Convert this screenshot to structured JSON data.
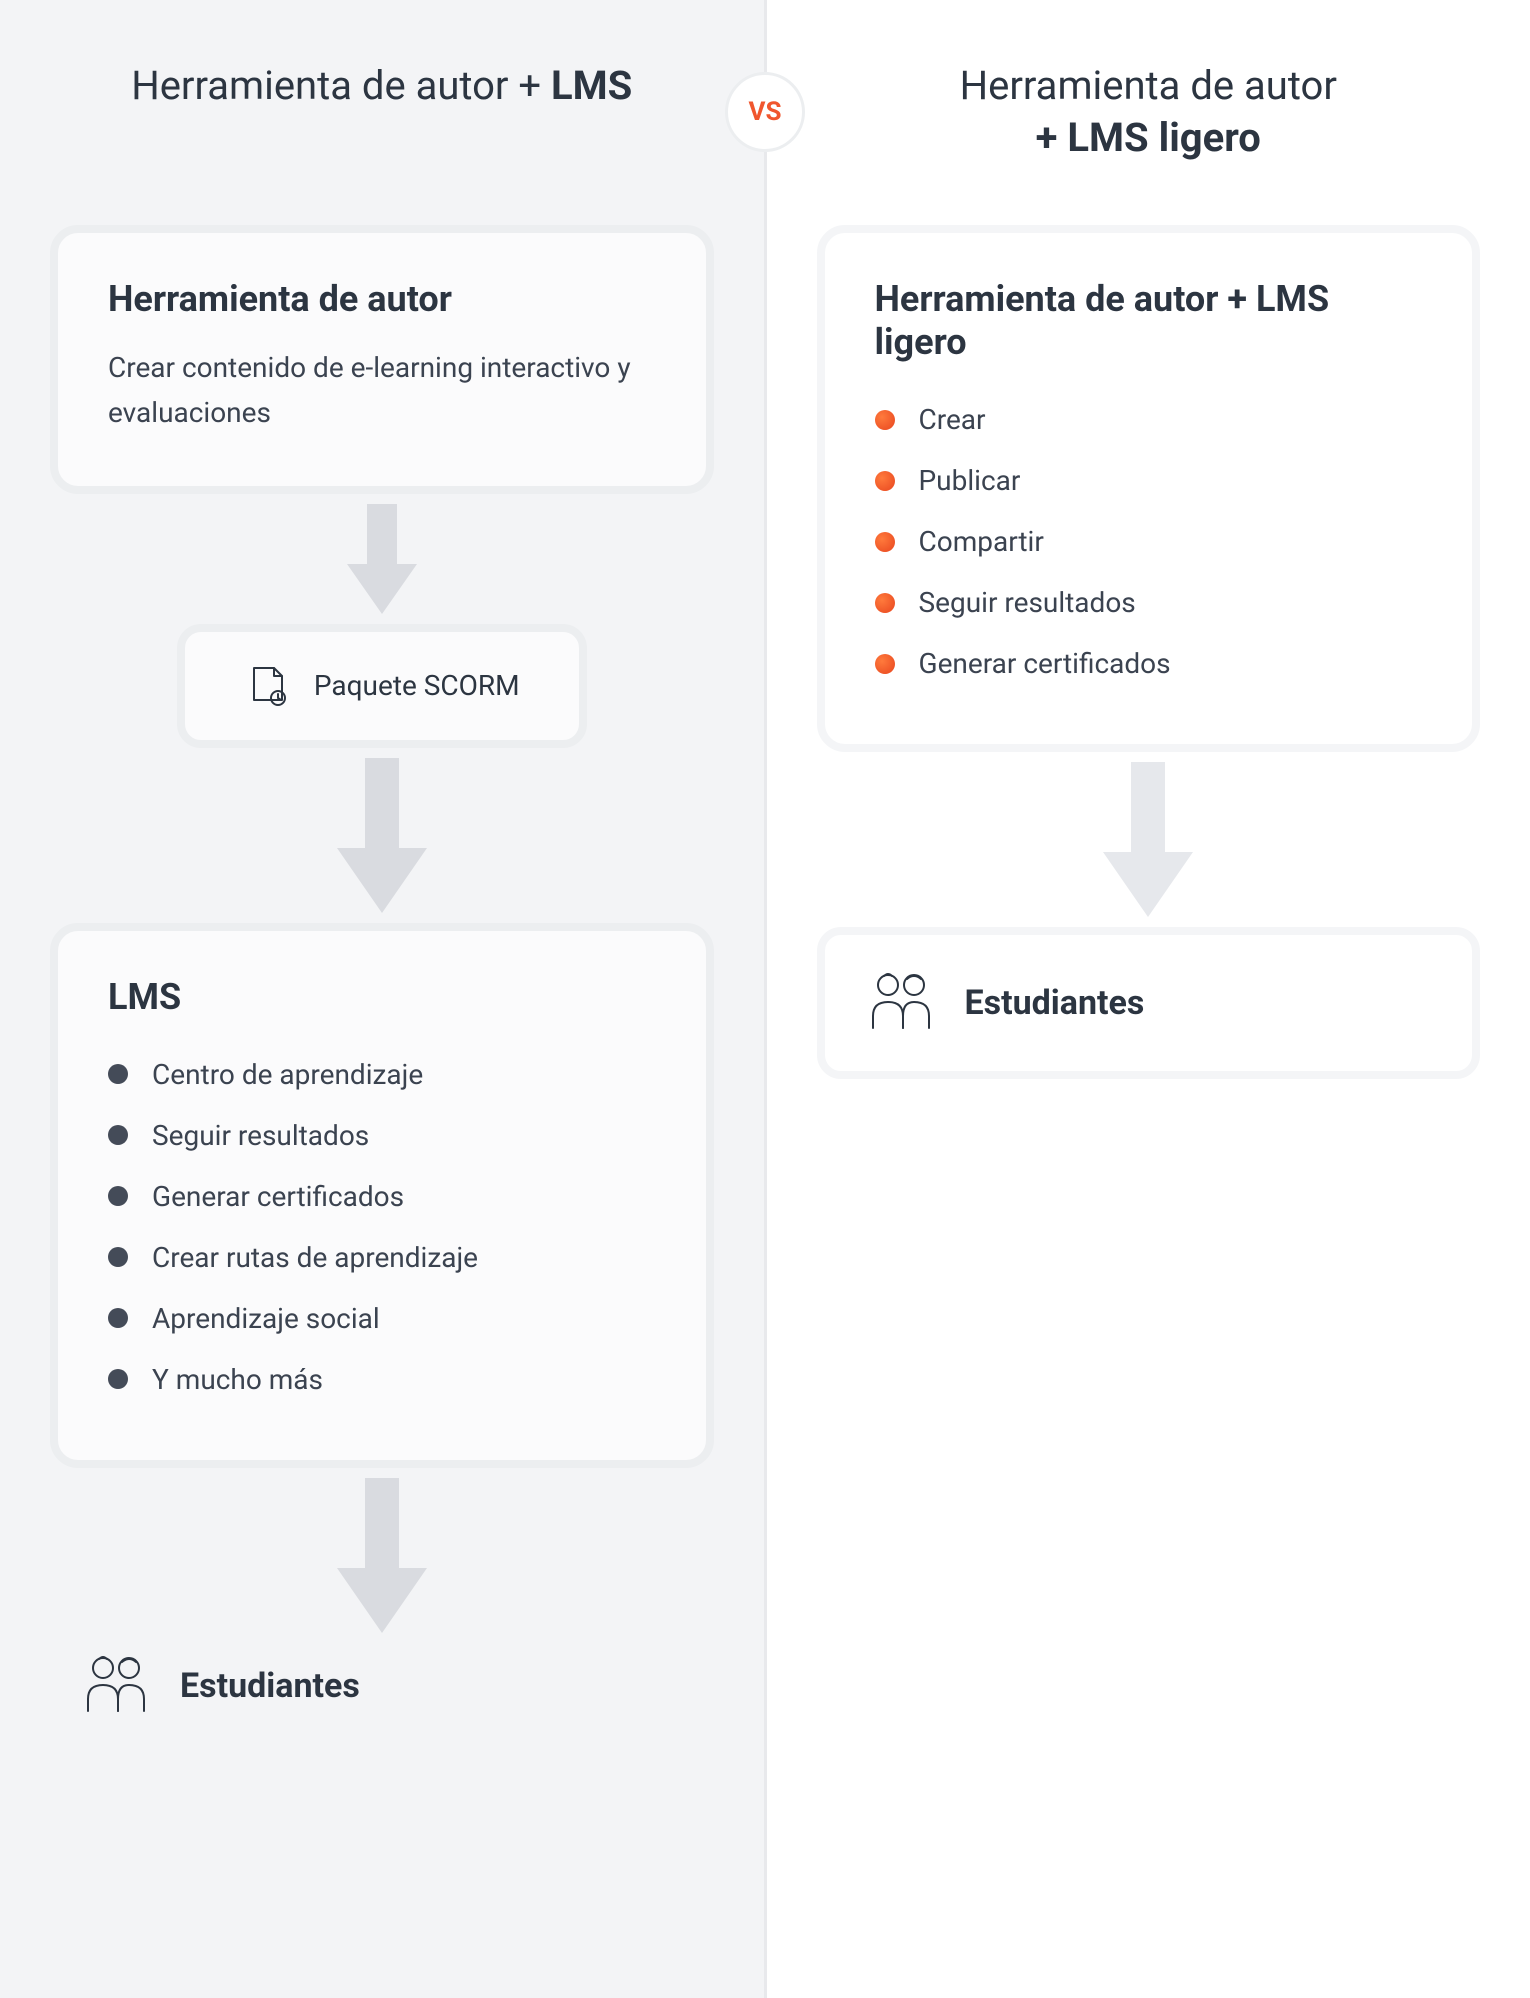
{
  "vs": "VS",
  "left": {
    "title_plain": "Herramienta de autor + ",
    "title_bold": "LMS",
    "card1": {
      "title": "Herramienta de autor",
      "desc": "Crear contenido de e-learning interactivo y evaluaciones"
    },
    "scorm": "Paquete SCORM",
    "card_lms": {
      "title": "LMS",
      "items": [
        "Centro de aprendizaje",
        "Seguir resultados",
        "Generar certificados",
        "Crear rutas de aprendizaje",
        "Aprendizaje social",
        "Y mucho más"
      ]
    },
    "students": "Estudiantes"
  },
  "right": {
    "title_plain": "Herramienta de autor",
    "title_bold": "+ LMS ligero",
    "card_main": {
      "title": "Herramienta de autor + LMS ligero",
      "items": [
        "Crear",
        "Publicar",
        "Compartir",
        "Seguir resultados",
        "Generar certificados"
      ]
    },
    "students": "Estudiantes"
  }
}
